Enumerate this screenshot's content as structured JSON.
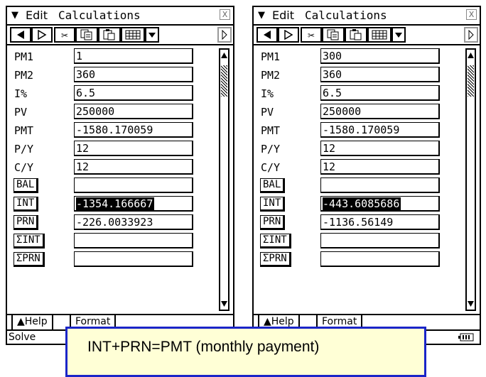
{
  "menu": {
    "chevron": "▼",
    "edit": "Edit",
    "calculations": "Calculations",
    "close": "X"
  },
  "toolbar": {
    "icons": [
      "back-arrow-icon",
      "play-icon",
      "cut-icon",
      "copy-icon",
      "paste-icon",
      "table-icon",
      "dropdown-icon",
      "scroll-right-icon"
    ]
  },
  "labels": [
    "PM1",
    "PM2",
    "I%",
    "PV",
    "PMT",
    "P/Y",
    "C/Y",
    "BAL",
    "INT",
    "PRN",
    "ΣINT",
    "ΣPRN"
  ],
  "left_values": [
    "1",
    "360",
    "6.5",
    "250000",
    "-1580.170059",
    "12",
    "12",
    "",
    "-1354.166667",
    "-226.0033923",
    "",
    ""
  ],
  "right_values": [
    "300",
    "360",
    "6.5",
    "250000",
    "-1580.170059",
    "12",
    "12",
    "",
    "-443.6085686",
    "-1136.56149",
    "",
    ""
  ],
  "tabs": {
    "help": "▲Help",
    "format": "Format"
  },
  "status": {
    "left_panel": "Solve",
    "battery": "battery-icon"
  },
  "callout": {
    "text": "INT+PRN=PMT (monthly payment)"
  },
  "colors": {
    "callout_bg": "#ffffd6",
    "callout_border": "#1a25c8"
  }
}
